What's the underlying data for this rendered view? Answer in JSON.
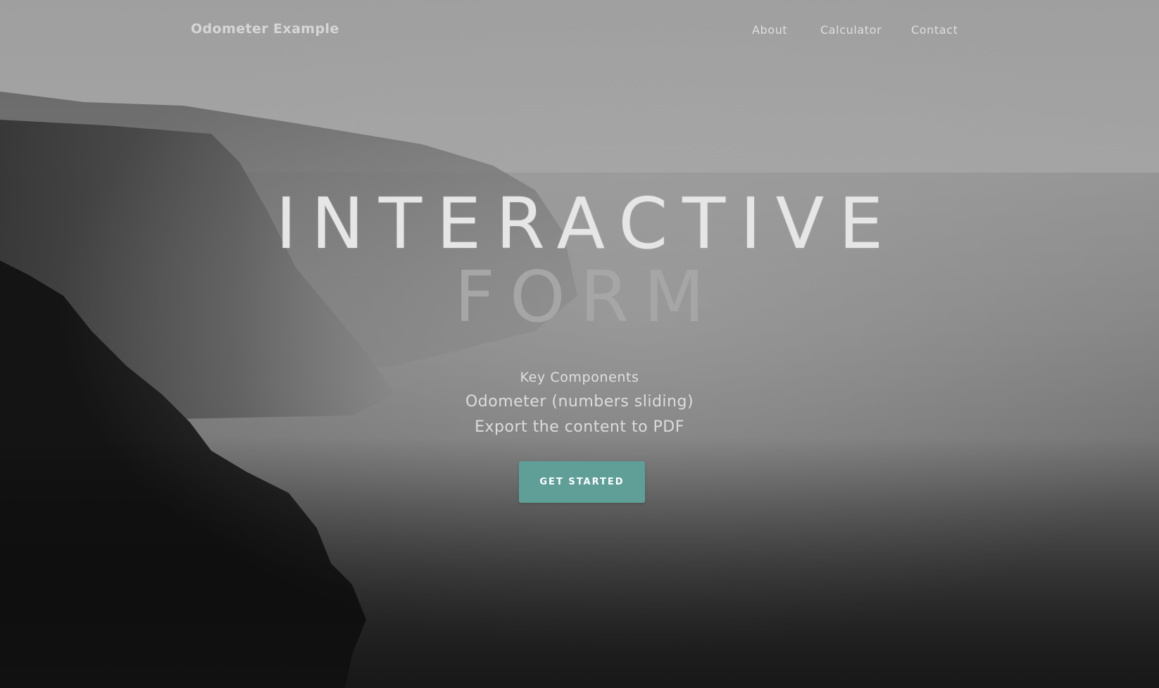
{
  "navbar": {
    "brand": "Odometer Example",
    "links": [
      {
        "label": "About"
      },
      {
        "label": "Calculator"
      },
      {
        "label": "Contact"
      }
    ]
  },
  "hero": {
    "title_line1": "INTERACTIVE",
    "title_line2": "FORM",
    "subtitle": "Key Components",
    "features": [
      "Odometer (numbers sliding)",
      "Export the content to PDF"
    ],
    "cta_label": "GET STARTED"
  },
  "colors": {
    "accent": "#5f9f98",
    "text_light": "#e0e0e0"
  }
}
